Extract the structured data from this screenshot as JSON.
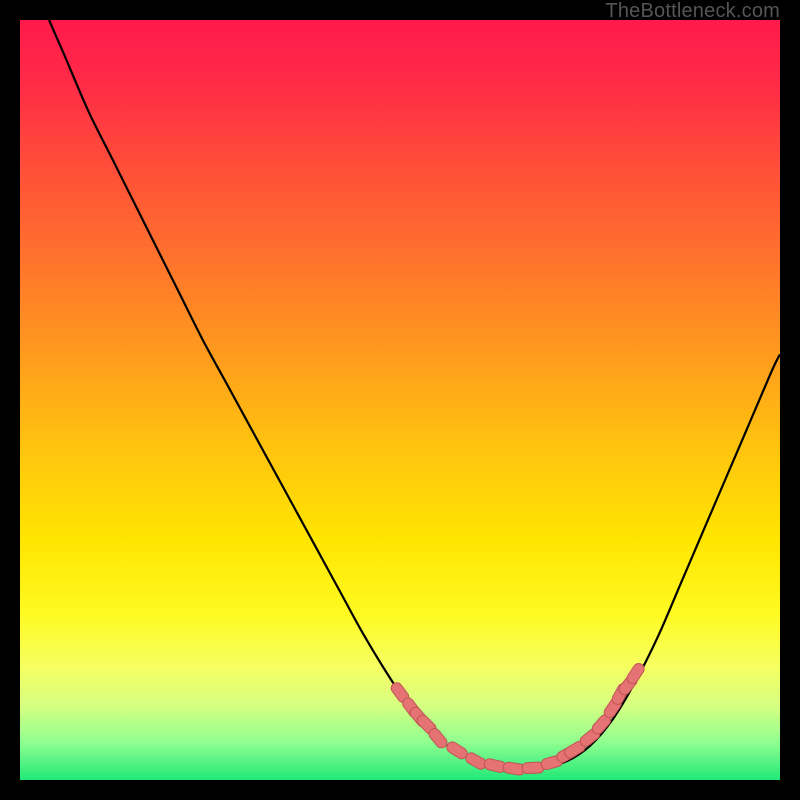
{
  "watermark": {
    "text": "TheBottleneck.com"
  },
  "colors": {
    "background": "#000000",
    "gradient_stops": [
      {
        "offset": 0.0,
        "color": "#ff1a4b"
      },
      {
        "offset": 0.08,
        "color": "#ff2a47"
      },
      {
        "offset": 0.18,
        "color": "#ff4a3a"
      },
      {
        "offset": 0.3,
        "color": "#ff6e2e"
      },
      {
        "offset": 0.42,
        "color": "#ff9420"
      },
      {
        "offset": 0.55,
        "color": "#ffc010"
      },
      {
        "offset": 0.68,
        "color": "#ffe400"
      },
      {
        "offset": 0.78,
        "color": "#fffa20"
      },
      {
        "offset": 0.85,
        "color": "#f6ff60"
      },
      {
        "offset": 0.9,
        "color": "#d8ff80"
      },
      {
        "offset": 0.95,
        "color": "#90ff90"
      },
      {
        "offset": 1.0,
        "color": "#20e878"
      }
    ],
    "curve_stroke": "#000000",
    "marker_fill": "#e57373",
    "marker_stroke": "#c05555"
  },
  "chart_data": {
    "type": "line",
    "title": "",
    "xlabel": "",
    "ylabel": "",
    "xlim": [
      0,
      100
    ],
    "ylim": [
      0,
      100
    ],
    "series": [
      {
        "name": "bottleneck-curve",
        "x": [
          0,
          3,
          6,
          9,
          12,
          15,
          18,
          21,
          24,
          27,
          30,
          33,
          36,
          39,
          42,
          45,
          48,
          51,
          54,
          57,
          60,
          63,
          66,
          69,
          72,
          75,
          78,
          81,
          84,
          87,
          90,
          93,
          96,
          99,
          100
        ],
        "values": [
          110,
          102,
          95,
          88,
          82,
          76,
          70,
          64,
          58,
          52.5,
          47,
          41.5,
          36,
          30.5,
          25,
          19.5,
          14.5,
          10,
          6.5,
          4,
          2.5,
          1.8,
          1.5,
          1.7,
          2.5,
          4.5,
          8,
          13,
          19,
          26,
          33,
          40,
          47,
          54,
          56
        ]
      }
    ],
    "markers": {
      "name": "highlight-dots",
      "x": [
        50,
        51.5,
        52.5,
        53.5,
        55,
        57.5,
        60,
        62.5,
        65,
        67.5,
        70,
        72,
        73,
        75,
        76.5,
        78,
        79,
        80,
        81
      ],
      "values": [
        11.5,
        9.5,
        8.3,
        7.3,
        5.5,
        3.9,
        2.5,
        1.9,
        1.5,
        1.6,
        2.3,
        3.4,
        4.0,
        5.6,
        7.3,
        9.5,
        11.3,
        12.5,
        14.0
      ]
    }
  }
}
